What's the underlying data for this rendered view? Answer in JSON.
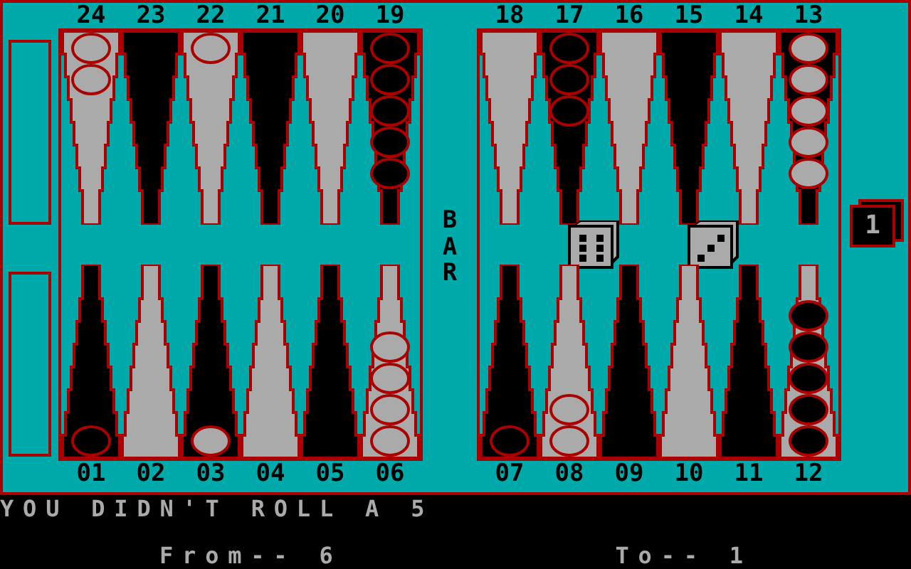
{
  "top": {
    "left": [
      {
        "label": "24",
        "kind": "light",
        "checkers": [
          {
            "kind": "light"
          },
          {
            "kind": "light"
          }
        ]
      },
      {
        "label": "23",
        "kind": "dark"
      },
      {
        "label": "22",
        "kind": "light",
        "checkers": [
          {
            "kind": "light"
          }
        ]
      },
      {
        "label": "21",
        "kind": "dark"
      },
      {
        "label": "20",
        "kind": "light"
      },
      {
        "label": "19",
        "kind": "dark",
        "checkers": [
          {
            "kind": "dark"
          },
          {
            "kind": "dark"
          },
          {
            "kind": "dark"
          },
          {
            "kind": "dark"
          },
          {
            "kind": "dark"
          }
        ]
      }
    ],
    "right": [
      {
        "label": "18",
        "kind": "light"
      },
      {
        "label": "17",
        "kind": "dark",
        "checkers": [
          {
            "kind": "dark"
          },
          {
            "kind": "dark"
          },
          {
            "kind": "dark"
          }
        ]
      },
      {
        "label": "16",
        "kind": "light"
      },
      {
        "label": "15",
        "kind": "dark"
      },
      {
        "label": "14",
        "kind": "light"
      },
      {
        "label": "13",
        "kind": "dark",
        "checkers": [
          {
            "kind": "light"
          },
          {
            "kind": "light"
          },
          {
            "kind": "light"
          },
          {
            "kind": "light"
          },
          {
            "kind": "light"
          }
        ]
      }
    ]
  },
  "bottom": {
    "left": [
      {
        "label": "01",
        "kind": "dark",
        "checkers": [
          {
            "kind": "dark"
          }
        ]
      },
      {
        "label": "02",
        "kind": "light"
      },
      {
        "label": "03",
        "kind": "dark",
        "checkers": [
          {
            "kind": "light"
          }
        ]
      },
      {
        "label": "04",
        "kind": "light"
      },
      {
        "label": "05",
        "kind": "dark"
      },
      {
        "label": "06",
        "kind": "light",
        "checkers": [
          {
            "kind": "light"
          },
          {
            "kind": "light"
          },
          {
            "kind": "light"
          },
          {
            "kind": "light"
          }
        ]
      }
    ],
    "right": [
      {
        "label": "07",
        "kind": "dark",
        "checkers": [
          {
            "kind": "dark"
          }
        ]
      },
      {
        "label": "08",
        "kind": "light",
        "checkers": [
          {
            "kind": "light"
          },
          {
            "kind": "light"
          }
        ]
      },
      {
        "label": "09",
        "kind": "dark"
      },
      {
        "label": "10",
        "kind": "light"
      },
      {
        "label": "11",
        "kind": "dark"
      },
      {
        "label": "12",
        "kind": "light",
        "checkers": [
          {
            "kind": "dark"
          },
          {
            "kind": "dark"
          },
          {
            "kind": "dark"
          },
          {
            "kind": "dark"
          },
          {
            "kind": "dark"
          }
        ]
      }
    ]
  },
  "bar": {
    "label": "BAR"
  },
  "dice": [
    {
      "kind": "six"
    },
    {
      "kind": "three"
    }
  ],
  "doubling_cube": {
    "value": "1"
  },
  "message": "YOU DIDN'T ROLL A 5",
  "from_prompt": "From-- 6",
  "to_prompt": "To-- 1"
}
